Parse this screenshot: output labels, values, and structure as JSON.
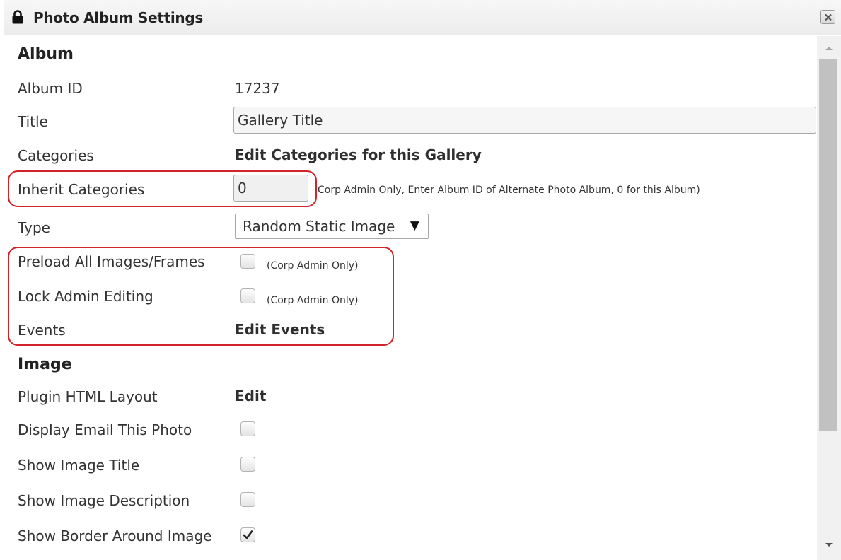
{
  "window": {
    "title": "Photo Album Settings",
    "icon": "lock-icon",
    "close_icon": "close-icon"
  },
  "sections": {
    "album": "Album",
    "image": "Image"
  },
  "album": {
    "album_id_label": "Album ID",
    "album_id_value": "17237",
    "title_label": "Title",
    "title_value": "Gallery Title",
    "categories_label": "Categories",
    "categories_link": "Edit Categories for this Gallery",
    "inherit_label": "Inherit Categories",
    "inherit_value": "0",
    "inherit_note": "Corp Admin Only, Enter Album ID of Alternate Photo Album, 0 for this Album)",
    "type_label": "Type",
    "type_value": "Random Static Image",
    "preload_label": "Preload All Images/Frames",
    "preload_checked": false,
    "preload_note": "(Corp Admin Only)",
    "lock_label": "Lock Admin Editing",
    "lock_checked": false,
    "lock_note": "(Corp Admin Only)",
    "events_label": "Events",
    "events_link": "Edit Events"
  },
  "image": {
    "layout_label": "Plugin HTML Layout",
    "layout_link": "Edit",
    "email_label": "Display Email This Photo",
    "email_checked": false,
    "show_title_label": "Show Image Title",
    "show_title_checked": false,
    "show_desc_label": "Show Image Description",
    "show_desc_checked": false,
    "border_label": "Show Border Around Image",
    "border_checked": true
  },
  "colors": {
    "highlight": "#d2232a",
    "scroll_thumb": "#c1c1c1"
  }
}
